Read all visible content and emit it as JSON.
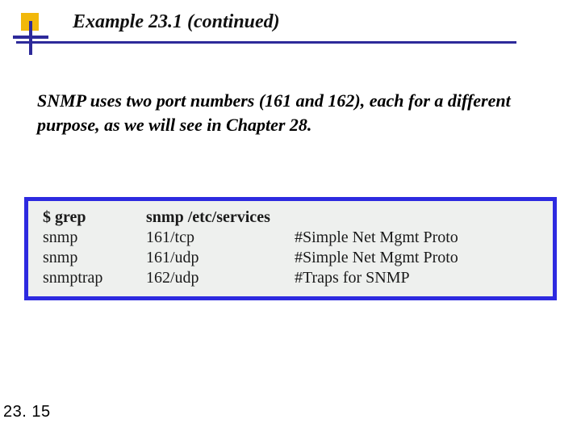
{
  "title": "Example 23.1 (continued)",
  "paragraph": "SNMP uses two port numbers (161 and 162), each for a different purpose, as we will see in Chapter 28.",
  "terminal": {
    "header": {
      "cmd": "$ grep",
      "arg": "snmp /etc/services",
      "comment": ""
    },
    "rows": [
      {
        "name": "snmp",
        "port": "161/tcp",
        "comment": "#Simple Net  Mgmt Proto"
      },
      {
        "name": "snmp",
        "port": "161/udp",
        "comment": "#Simple Net  Mgmt Proto"
      },
      {
        "name": "snmptrap",
        "port": "162/udp",
        "comment": "#Traps for SNMP"
      }
    ]
  },
  "page_number": "23. 15"
}
